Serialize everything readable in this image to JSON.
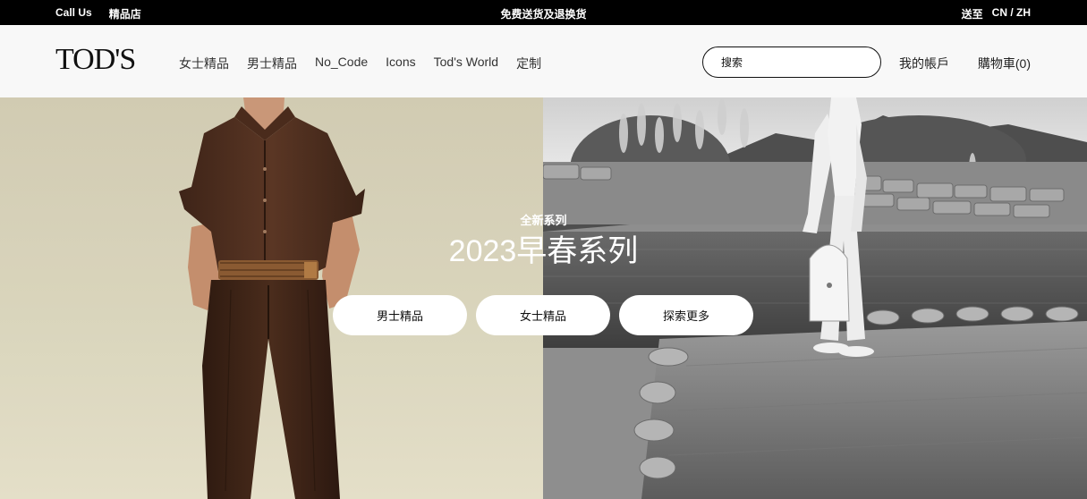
{
  "topbar": {
    "call_us": "Call Us",
    "stores": "精品店",
    "promo": "免费送货及退换货",
    "ship_to": "送至",
    "locale": "CN / ZH"
  },
  "header": {
    "logo": "TOD'S",
    "nav": [
      "女士精品",
      "男士精品",
      "No_Code",
      "Icons",
      "Tod's World",
      "定制"
    ],
    "search_placeholder": "搜索",
    "account": "我的帳戶",
    "cart": "購物車(0)"
  },
  "hero": {
    "kicker": "全新系列",
    "headline": "2023早春系列",
    "buttons": [
      "男士精品",
      "女士精品",
      "探索更多"
    ]
  }
}
